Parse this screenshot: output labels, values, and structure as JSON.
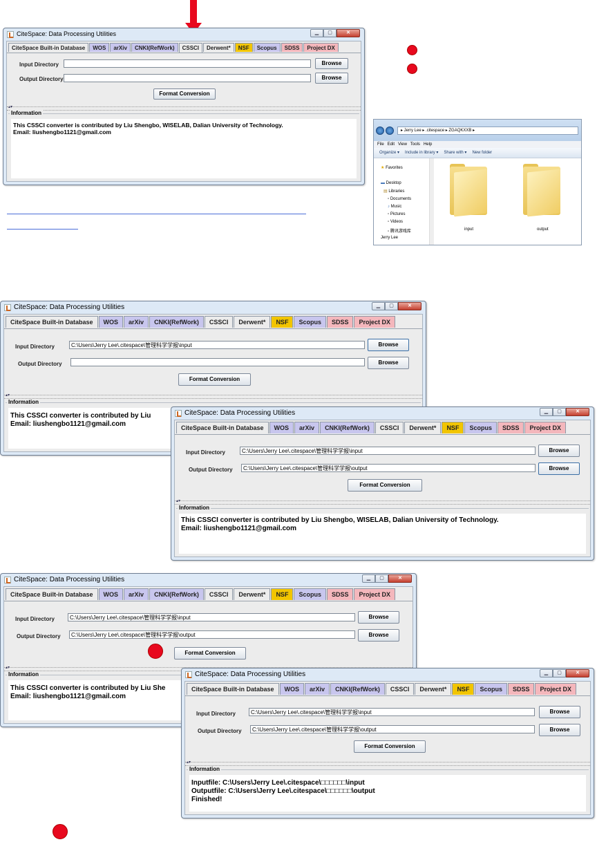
{
  "app": {
    "window_title": "CiteSpace: Data Processing Utilities",
    "tabs": [
      {
        "label": "CiteSpace Built-in Database",
        "style": "plain"
      },
      {
        "label": "WOS",
        "style": "lav"
      },
      {
        "label": "arXiv",
        "style": "lav"
      },
      {
        "label": "CNKI(RefWork)",
        "style": "lav"
      },
      {
        "label": "CSSCI",
        "style": "active"
      },
      {
        "label": "Derwent*",
        "style": "plain"
      },
      {
        "label": "NSF",
        "style": "yel"
      },
      {
        "label": "Scopus",
        "style": "lav"
      },
      {
        "label": "SDSS",
        "style": "pink"
      },
      {
        "label": "Project DX",
        "style": "pink"
      }
    ],
    "input_label": "Input Directory",
    "output_label": "Output Directory",
    "browse_label": "Browse",
    "convert_label": "Format Conversion",
    "info_label": "Information",
    "info_default": [
      "This CSSCI converter is contributed by Liu Shengbo, WISELAB, Dalian University of Technology.",
      "Email: liushengbo1121@gmail.com"
    ],
    "info_truncated_1": "This CSSCI converter is contributed by Liu",
    "info_truncated_3": "This CSSCI converter is contributed by Liu She",
    "email": "Email: liushengbo1121@gmail.com",
    "info_finished": [
      "Inputfile: C:\\Users\\Jerry Lee\\.citespace\\□□□□□□\\input",
      "Outputfile: C:\\Users\\Jerry Lee\\.citespace\\□□□□□□\\output",
      "Finished!"
    ]
  },
  "paths": {
    "input": "C:\\Users\\Jerry Lee\\.citespace\\管理科学学报\\input",
    "output": "C:\\Users\\Jerry Lee\\.citespace\\管理科学学报\\output"
  },
  "explorer": {
    "address": "▸ Jerry Lee ▸ .citespace ▸ ZGAQKXXB ▸",
    "menu": [
      "File",
      "Edit",
      "View",
      "Tools",
      "Help"
    ],
    "commands": [
      "Organize ▾",
      "Include in library ▾",
      "Share with ▾",
      "New folder"
    ],
    "nav": [
      "Favorites",
      "Desktop",
      "Libraries",
      "Documents",
      "Music",
      "Pictures",
      "Videos",
      "腾讯游戏库",
      "Jerry Lee"
    ],
    "folders": [
      "input",
      "output"
    ]
  },
  "colors": {
    "marker": "#e8091e",
    "window_frame": "#dde9f6",
    "client_bg": "#ececec"
  }
}
